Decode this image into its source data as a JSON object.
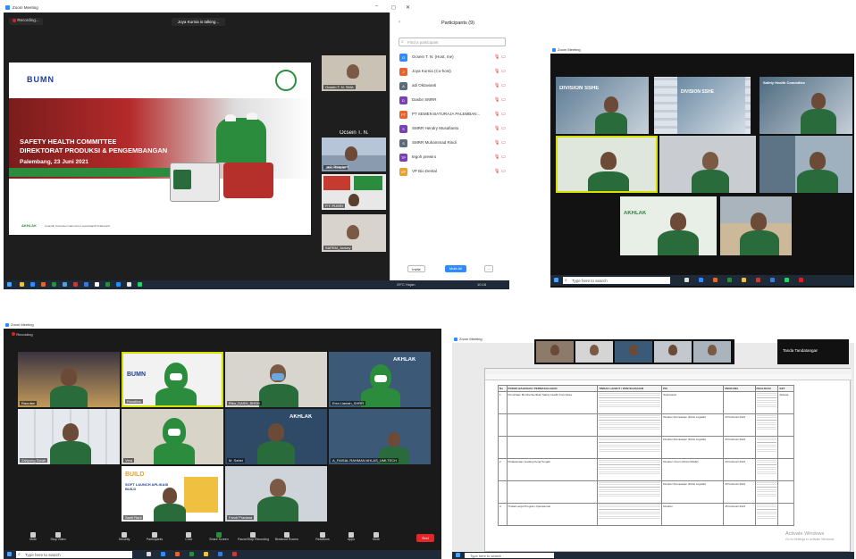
{
  "q1": {
    "window_title": "Zoom Meeting",
    "recording_label": "Recording...",
    "talking_banner": "Joya Kurnia is talking...",
    "slide": {
      "logo_text": "BUMN",
      "title_line1": "SAFETY HEALTH COMMITTEE",
      "title_line2": "DIREKTORAT PRODUKSI & PENGEMBANGAN",
      "date_line": "Palembang, 23 Juni 2021",
      "footer_text": "AKHLAK",
      "footer_sub": "Amanah Kompeten Harmonis Loyal Adaptif Kolaboratif"
    },
    "speaker_name": "Ocsein T. N.",
    "thumbs": [
      "Ocsein T. N. SMA",
      "Joko Ridwan",
      "adi Oktavianti",
      "P.T. PUSRI",
      "SAFEM_Jockey"
    ],
    "participants": {
      "title": "Participants (9)",
      "search_placeholder": "Find a participant",
      "items": [
        {
          "initials": "O",
          "color": "#2d8cff",
          "name": "Ocsein T. N. (Host, me)"
        },
        {
          "initials": "J",
          "color": "#e8622c",
          "name": "Joya Kurnia (Co-host)"
        },
        {
          "initials": "A",
          "color": "#5a6b7b",
          "name": "adi Oktavianti"
        },
        {
          "initials": "D",
          "color": "#7b3fb5",
          "name": "Dasbn SMRR"
        },
        {
          "initials": "PT",
          "color": "#e8622c",
          "name": "PT SEMEN BATURAJA PALEMBAN..."
        },
        {
          "initials": "S",
          "color": "#7b3fb5",
          "name": "SMRR Hendry Musafianto"
        },
        {
          "initials": "S",
          "color": "#5a6b7b",
          "name": "SMRR Muhammad Rindi"
        },
        {
          "initials": "TP",
          "color": "#7b3fb5",
          "name": "tegoh prewiro"
        },
        {
          "initials": "VP",
          "color": "#e8a12c",
          "name": "VP Bio Dental"
        }
      ],
      "invite_label": "Invite",
      "mute_all_label": "Mute All",
      "more_label": "..."
    },
    "taskbar": {
      "weather": "29°C Hujan",
      "time": "10:18"
    }
  },
  "q2": {
    "window_title": "Zoom Meeting",
    "tile_texts": [
      "DIVISION SSHE",
      "DIVISION SSHE",
      "Safety Health Committee",
      "AKHLAK"
    ],
    "search_placeholder": "Type here to search"
  },
  "q3": {
    "window_title": "Zoom Meeting",
    "recording_label": "Recording",
    "names": [
      "Raoufan",
      "Rosalina",
      "Riko_DASH_SHSH",
      "Erra Lianiah_SHRR",
      "Zahyung Sarah",
      "Vera",
      "M. Sahid",
      "A_FAISAL RAHMAN AHLAS_UMLTECH",
      "Santi Rani",
      "Fandi Pradana"
    ],
    "tile_texts": [
      "BUMN",
      "AKHLAK",
      "AKHLAK",
      "BUILD",
      "SOFT LAUNCH APLIKASI BUILD"
    ],
    "controls": [
      "Mute",
      "Stop Video",
      "Security",
      "Participants",
      "Chat",
      "Share Screen",
      "Pause/Stop Recording",
      "Breakout Rooms",
      "Reactions",
      "Apps",
      "More"
    ],
    "end_label": "End",
    "search_placeholder": "Type here to search"
  },
  "q4": {
    "window_title": "Zoom Meeting",
    "side_label": "Tanda Tandatangan",
    "table": {
      "headers": [
        "No",
        "POKOK BAHASAN / PERMASALAHAN",
        "TINDAK LANJUT / PENYELESAIAN",
        "PIC",
        "RENCANA",
        "REALISASI",
        "KET"
      ],
      "rows": [
        {
          "no": "1",
          "topic": "Pemintaan Memberhentikan Safety Health Committee",
          "pic": "Sekretariat",
          "plan": "",
          "ket": "Selesai"
        },
        {
          "no": "",
          "topic": "",
          "pic": "Direktur Pemasaran (Divisi Logistik)",
          "plan": "23 Februari 2021",
          "ket": ""
        },
        {
          "no": "",
          "topic": "",
          "pic": "Direktur Pemasaran (Divisi Logistik)",
          "plan": "23 Februari 2021",
          "ket": ""
        },
        {
          "no": "2",
          "topic": "Pelaksanaan Gudang Kerja Tengah",
          "pic": "Direktur Umum (Divisi SSHE)",
          "plan": "23 Februari 2021",
          "ket": ""
        },
        {
          "no": "",
          "topic": "",
          "pic": "Direktur Pemasaran (Divisi Logistik)",
          "plan": "23 Februari 2021",
          "ket": ""
        },
        {
          "no": "3",
          "topic": "Tindak Lanjut Program Operasional",
          "pic": "Direktur",
          "plan": "25 Februari 2021",
          "ket": ""
        }
      ]
    },
    "watermark_line1": "Activate Windows",
    "watermark_line2": "Go to Settings to activate Windows.",
    "search_placeholder": "Type here to search"
  }
}
